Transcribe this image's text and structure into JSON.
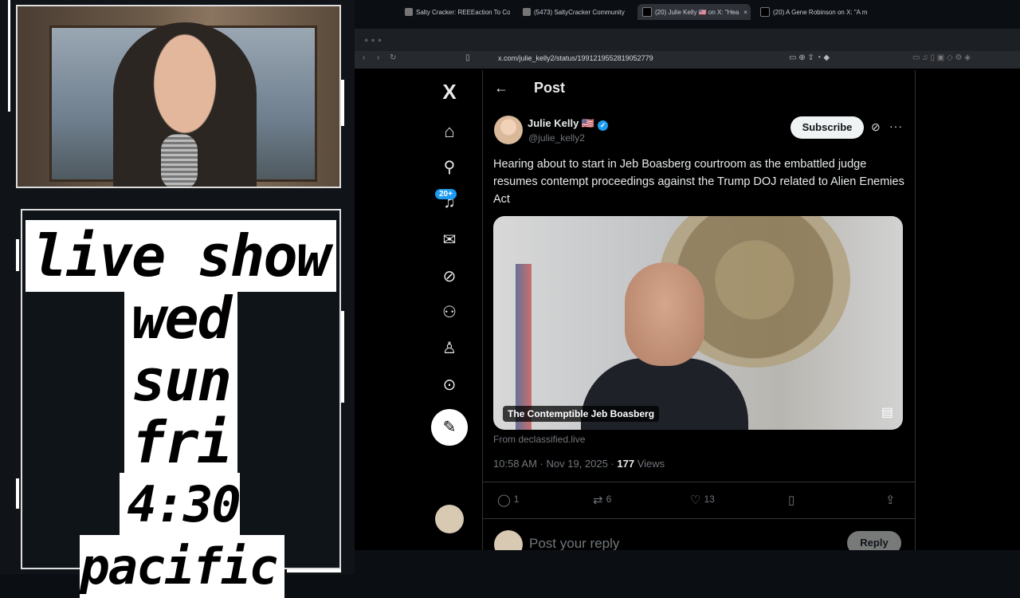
{
  "promo": {
    "lines": [
      "live show",
      "wed",
      "sun",
      "fri",
      "4:30 pacific"
    ]
  },
  "browser": {
    "tabs": [
      {
        "label": "Salty Cracker: REEEaction To Co"
      },
      {
        "label": "(5473) SaltyCracker Community"
      },
      {
        "label": "(20) Julie Kelly 🇺🇸 on X: \"Hea"
      },
      {
        "label": "(20) A Gene Robinson on X: \"A m"
      }
    ],
    "url": "x.com/julie_kelly2/status/1991219552819052779"
  },
  "x": {
    "logo": "X",
    "notification_badge": "20+",
    "icons": [
      "home-icon",
      "search-icon",
      "notifications-icon",
      "messages-icon",
      "grok-icon",
      "communities-icon",
      "profile-icon",
      "more-icon"
    ]
  },
  "post": {
    "header_title": "Post",
    "author_name": "Julie Kelly 🇺🇸",
    "author_handle": "@julie_kelly2",
    "subscribe_label": "Subscribe",
    "text": "Hearing about to start in Jeb Boasberg courtroom as the embattled judge resumes contempt proceedings against the Trump DOJ related to Alien Enemies Act",
    "media_caption": "The Contemptible Jeb Boasberg",
    "from_source": "From declassified.live",
    "time": "10:58 AM · Nov 19, 2025 · ",
    "views_count": "177",
    "views_label": " Views",
    "replies": "1",
    "reposts": "6",
    "likes": "13",
    "reply_placeholder": "Post your reply",
    "reply_button": "Reply"
  }
}
